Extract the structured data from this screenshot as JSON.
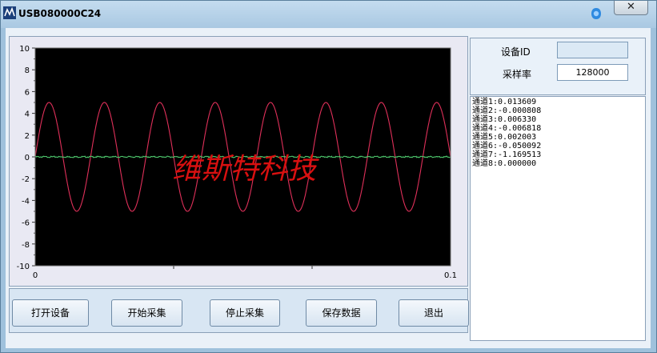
{
  "window": {
    "title": "USB080000C24",
    "close_label": "✕"
  },
  "chart_data": {
    "type": "line",
    "watermark": "维斯特科技",
    "xlim": [
      0,
      0.1
    ],
    "ylim": [
      -10,
      10
    ],
    "x_ticks": [
      "0",
      "0.1"
    ],
    "y_ticks": [
      "10",
      "8",
      "6",
      "4",
      "2",
      "0",
      "-2",
      "-4",
      "-6",
      "-8",
      "-10"
    ],
    "background": "#000000",
    "series": [
      {
        "color": "#e0305a",
        "waveform": "sine",
        "amplitude": 5.0,
        "offset": 0,
        "cycles": 7.5,
        "phase_deg": 0
      },
      {
        "color": "#4cc46a",
        "waveform": "flat-noise",
        "level": 0.0
      }
    ]
  },
  "controls": {
    "open_device": "打开设备",
    "start_capture": "开始采集",
    "stop_capture": "停止采集",
    "save_data": "保存数据",
    "exit": "退出"
  },
  "device": {
    "id_label": "设备ID",
    "id_value": "",
    "rate_label": "采样率",
    "rate_value": "128000"
  },
  "channels": [
    "通道1:0.013609",
    "通道2:-0.000808",
    "通道3:0.006330",
    "通道4:-0.006818",
    "通道5:0.002003",
    "通道6:-0.050092",
    "通道7:-1.169513",
    "通道8:0.000000"
  ]
}
